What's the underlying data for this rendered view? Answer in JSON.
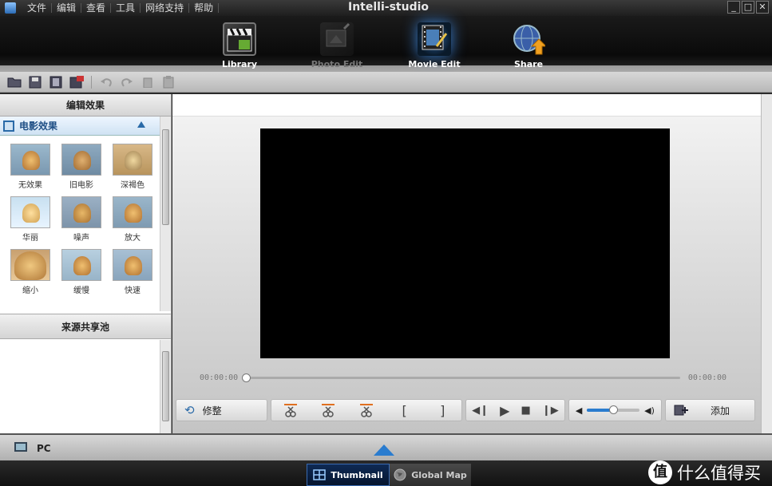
{
  "menu": [
    "文件",
    "编辑",
    "查看",
    "工具",
    "网络支持",
    "帮助"
  ],
  "app_title": "Intelli-studio",
  "window_controls": {
    "minimize": "_",
    "maximize": "□",
    "close": "✕"
  },
  "mode_tabs": [
    {
      "label": "Library",
      "icon": "clapperboard-icon",
      "state": "normal"
    },
    {
      "label": "Photo Edit",
      "icon": "photo-edit-icon",
      "state": "disabled"
    },
    {
      "label": "Movie Edit",
      "icon": "film-edit-icon",
      "state": "active"
    },
    {
      "label": "Share",
      "icon": "globe-share-icon",
      "state": "normal"
    }
  ],
  "colors": {
    "active_tab": "#ffffff",
    "disabled_tab": "#777777",
    "accent": "#2a7ccf",
    "section_text": "#1f4f85"
  },
  "left_panel": {
    "header": "编辑效果",
    "section": "电影效果",
    "effects": [
      "无效果",
      "旧电影",
      "深褐色",
      "华丽",
      "噪声",
      "放大",
      "缩小",
      "缓慢",
      "快速"
    ],
    "source_header": "来源共享池"
  },
  "player": {
    "time_start": "00:00:00",
    "time_end": "00:00:00",
    "progress": 0.0,
    "volume": 0.5,
    "trim_label": "修整",
    "add_label": "添加"
  },
  "bottom": {
    "pc_label": "PC",
    "view_tabs": [
      {
        "label": "Thumbnail",
        "active": true
      },
      {
        "label": "Global Map",
        "active": false
      }
    ]
  },
  "watermark": {
    "icon_text": "值",
    "text": "什么值得买"
  }
}
